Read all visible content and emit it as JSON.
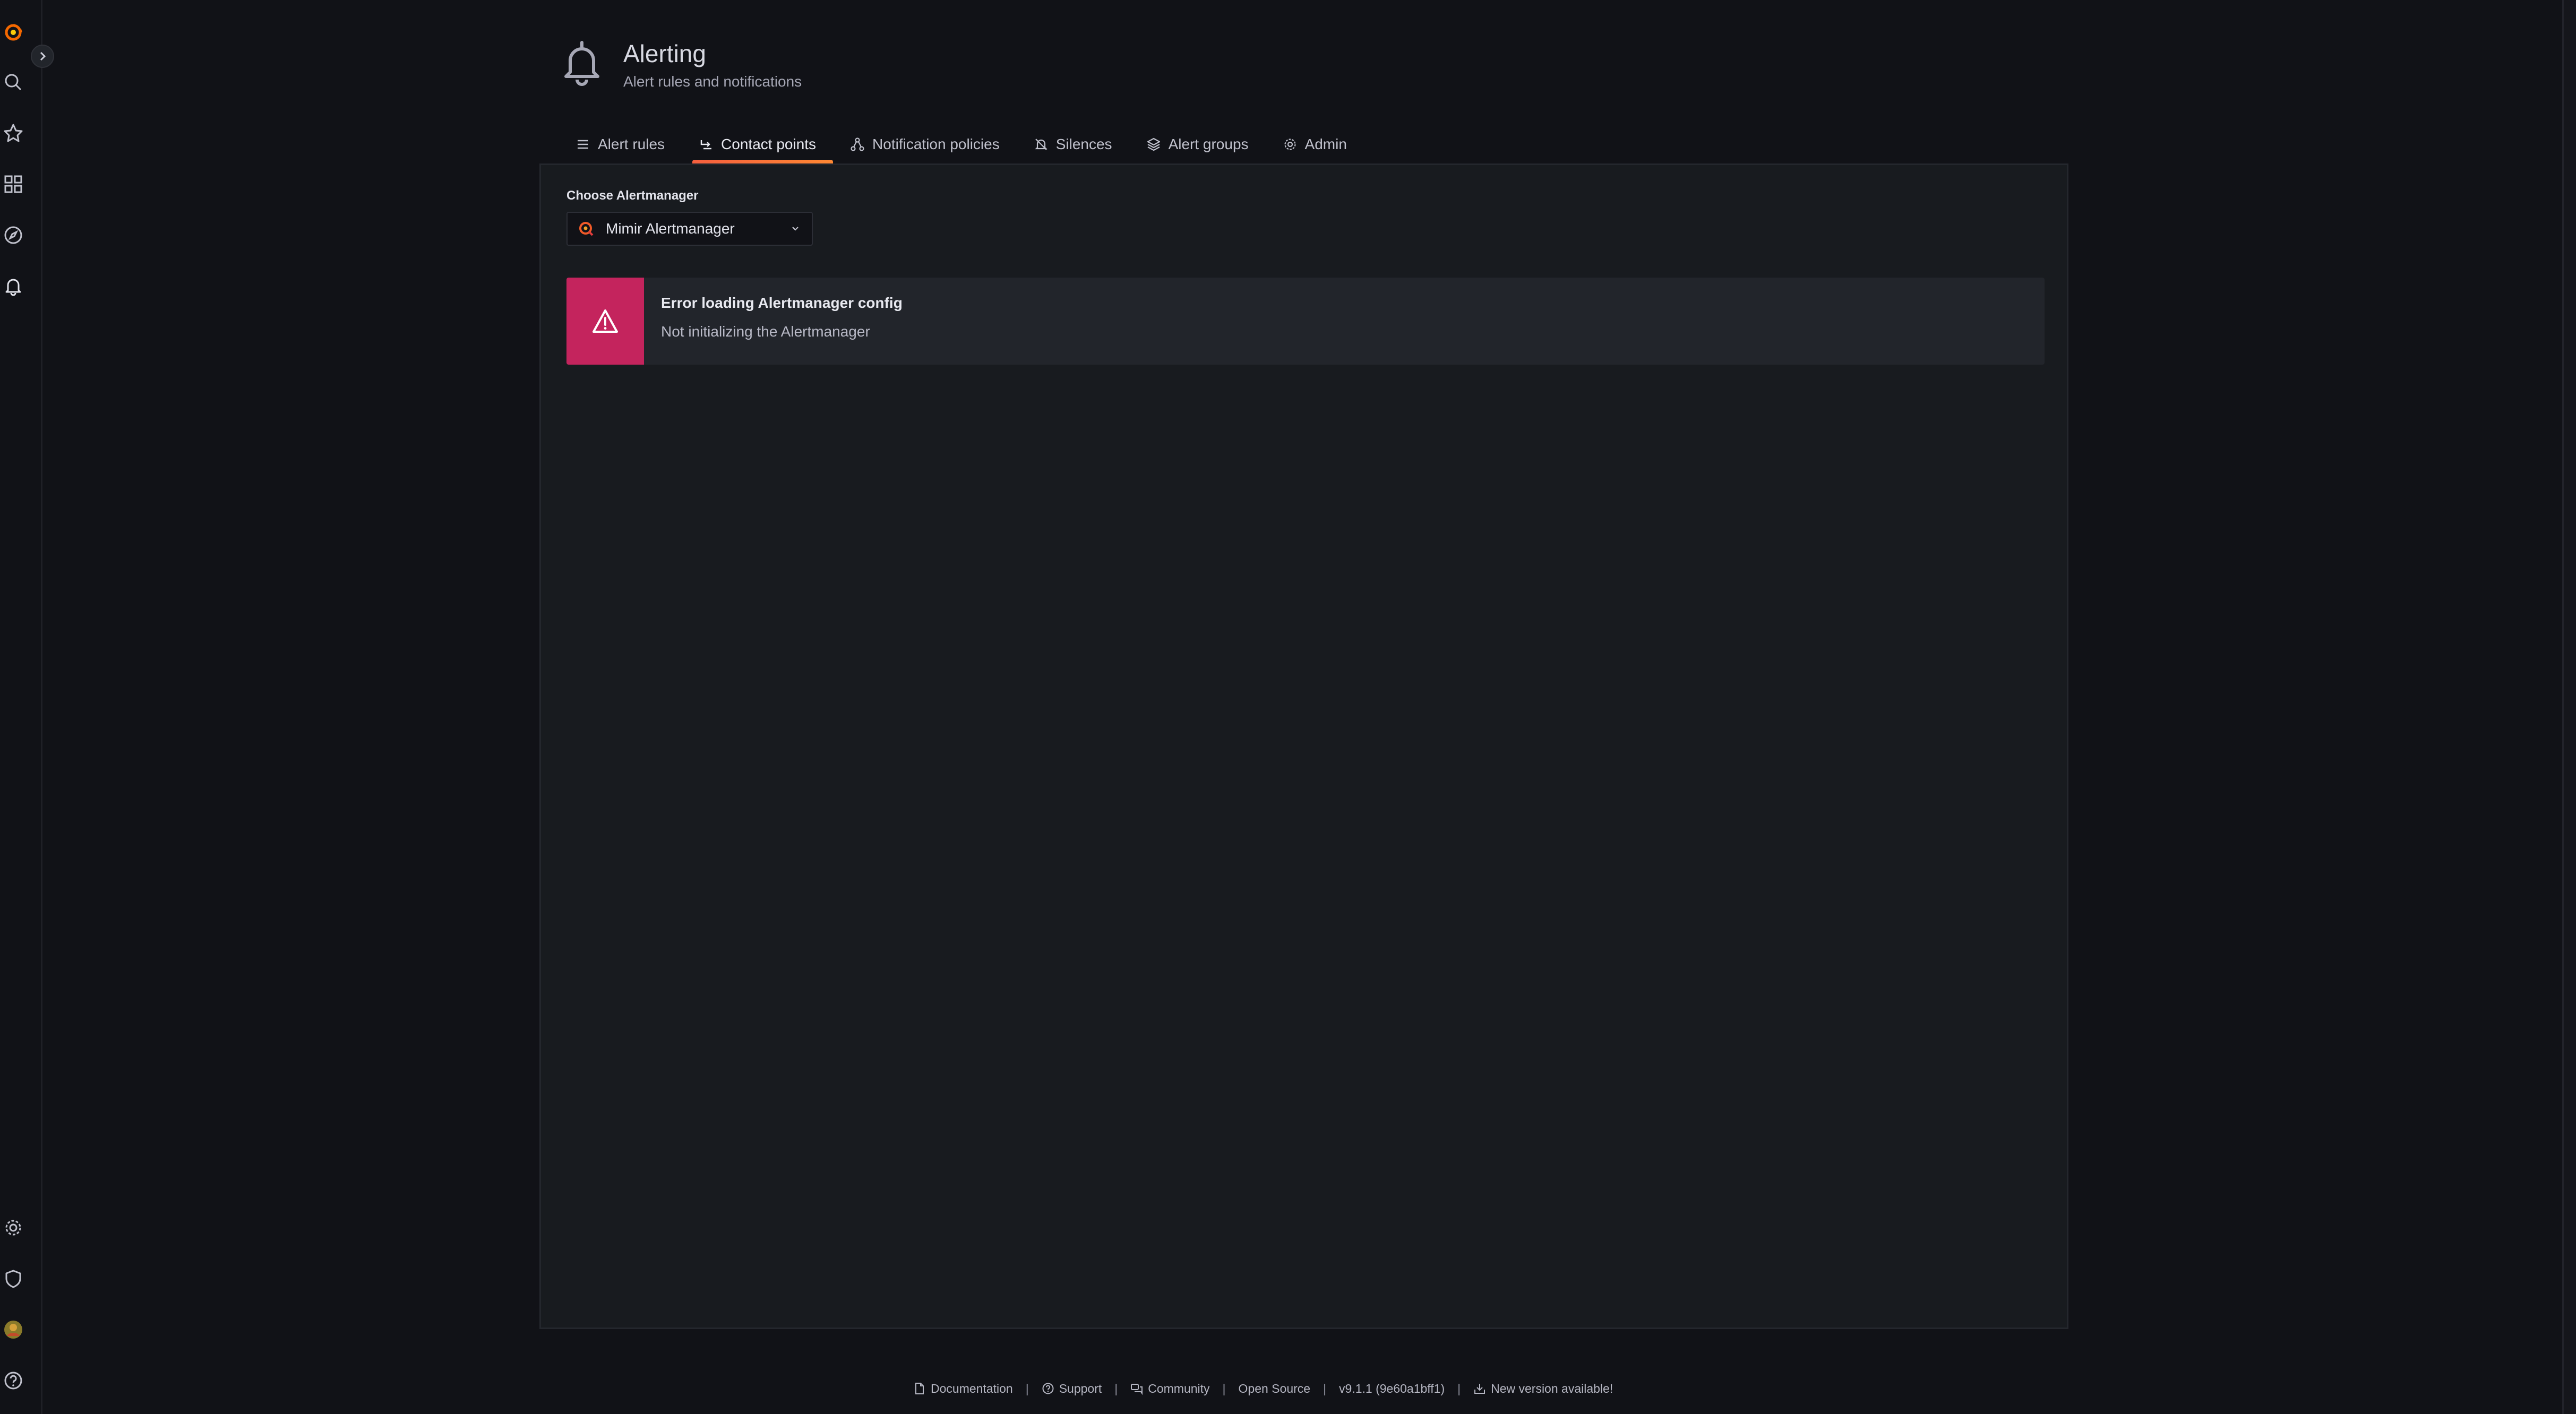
{
  "header": {
    "title": "Alerting",
    "subtitle": "Alert rules and notifications",
    "icon": "bell-icon"
  },
  "tabs": [
    {
      "label": "Alert rules",
      "icon": "list-icon",
      "active": false
    },
    {
      "label": "Contact points",
      "icon": "contact-icon",
      "active": true
    },
    {
      "label": "Notification policies",
      "icon": "sitemap-icon",
      "active": false
    },
    {
      "label": "Silences",
      "icon": "bell-slash-icon",
      "active": false
    },
    {
      "label": "Alert groups",
      "icon": "layers-icon",
      "active": false
    },
    {
      "label": "Admin",
      "icon": "cog-icon",
      "active": false
    }
  ],
  "alertmanager": {
    "label": "Choose Alertmanager",
    "selected": "Mimir Alertmanager"
  },
  "error": {
    "title": "Error loading Alertmanager config",
    "description": "Not initializing the Alertmanager"
  },
  "footer": {
    "documentation": "Documentation",
    "support": "Support",
    "community": "Community",
    "open_source": "Open Source",
    "version": "v9.1.1 (9e60a1bff1)",
    "new_version": "New version available!",
    "separator": "|"
  },
  "sidebar": {
    "top_icons": [
      "grafana-logo-icon",
      "search-icon",
      "star-icon",
      "dashboards-icon",
      "explore-icon",
      "alerting-bell-icon"
    ],
    "bottom_icons": [
      "cog-icon",
      "shield-icon",
      "avatar",
      "help-icon"
    ]
  },
  "colors": {
    "background": "#111217",
    "panel": "#181b1f",
    "error_accent": "#c4245d",
    "tab_underline": "#f55f3e",
    "brand_orange": "#f05a28"
  }
}
